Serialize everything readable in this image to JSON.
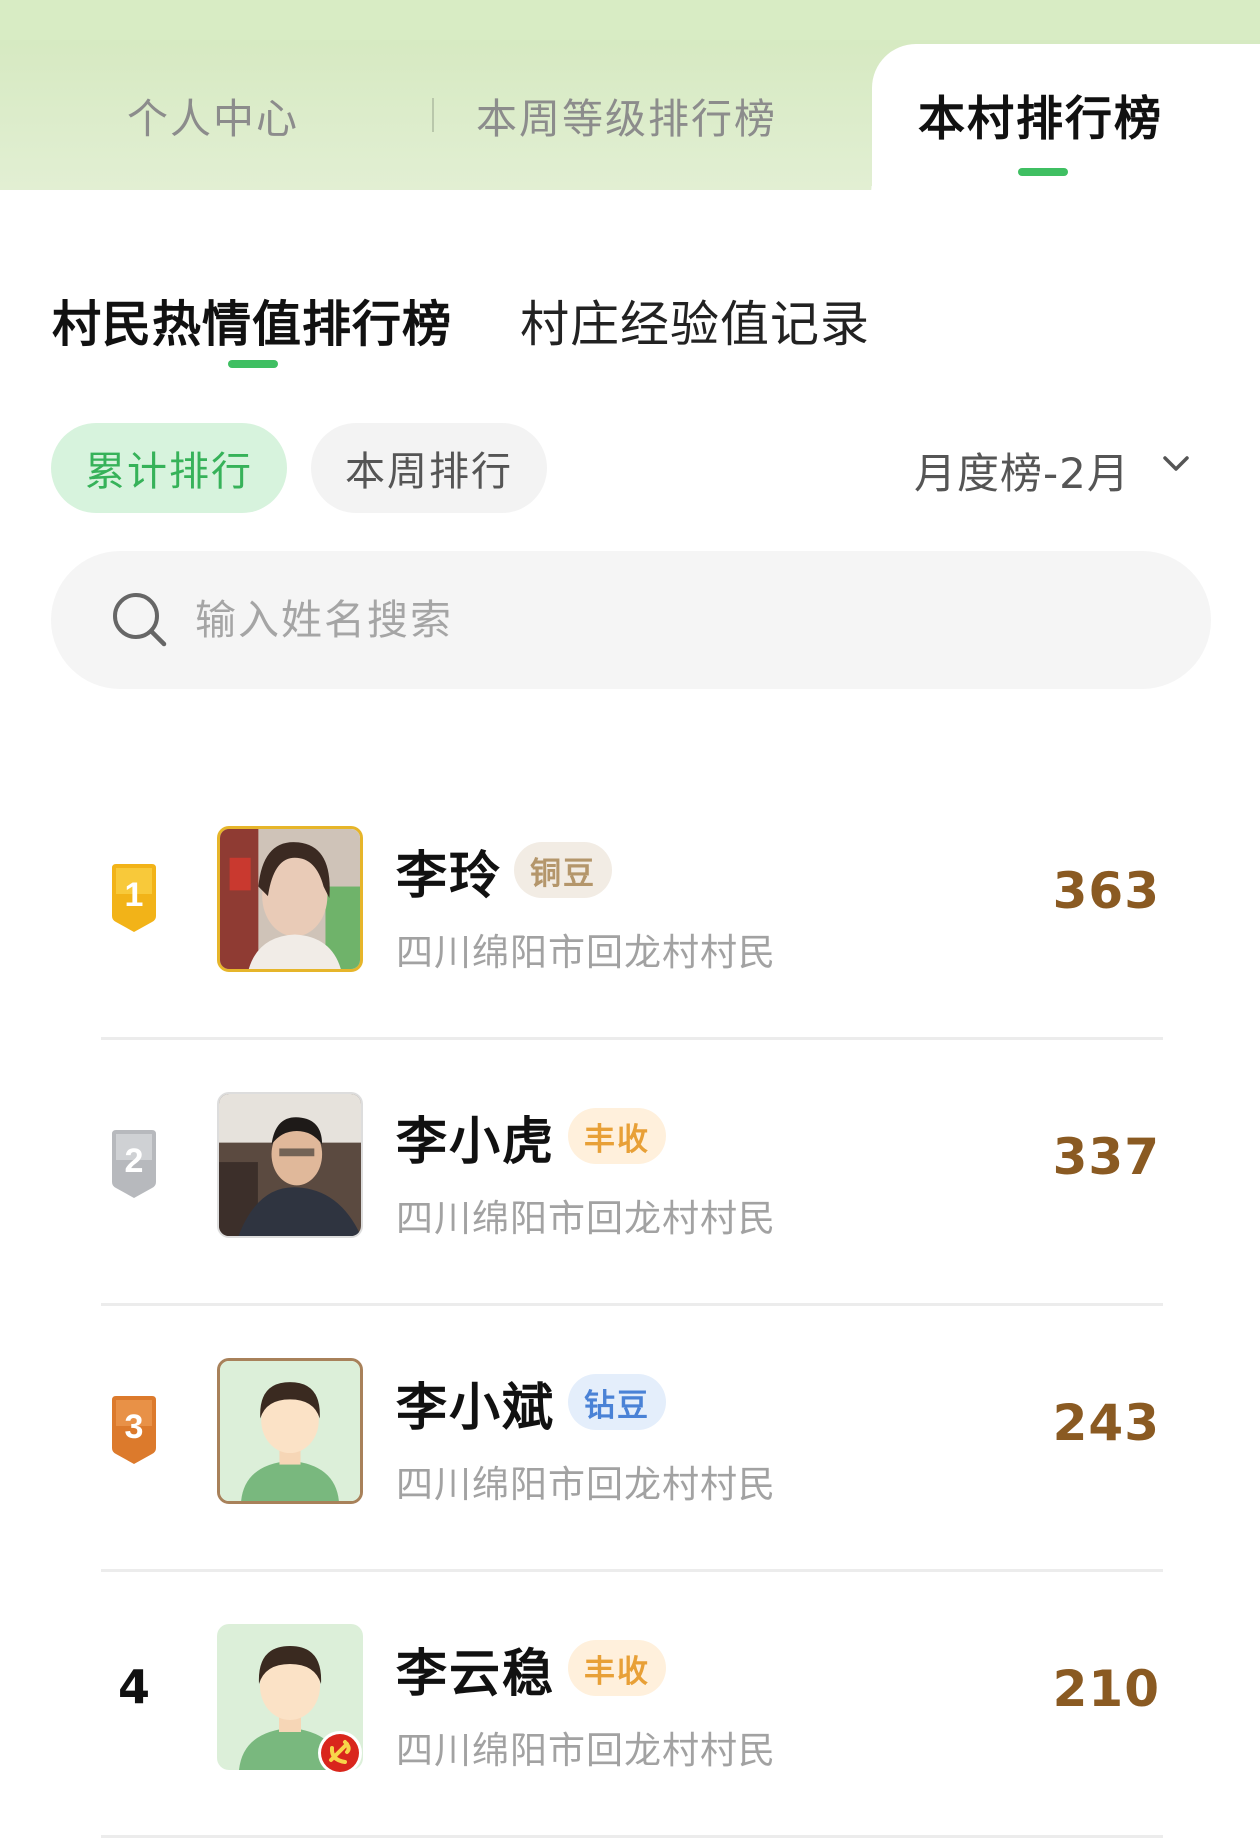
{
  "top_tabs": [
    {
      "label": "个人中心"
    },
    {
      "label": "本周等级排行榜"
    },
    {
      "label": "本村排行榜"
    }
  ],
  "sub_tabs": [
    {
      "label": "村民热情值排行榜"
    },
    {
      "label": "村庄经验值记录"
    }
  ],
  "filters": {
    "total_label": "累计排行",
    "week_label": "本周排行",
    "period_label": "月度榜-2月"
  },
  "search": {
    "placeholder": "输入姓名搜索"
  },
  "ranking": [
    {
      "rank": "1",
      "name": "李玲",
      "tag": "铜豆",
      "location": "四川绵阳市回龙村村民",
      "score": "363"
    },
    {
      "rank": "2",
      "name": "李小虎",
      "tag": "丰收",
      "location": "四川绵阳市回龙村村民",
      "score": "337"
    },
    {
      "rank": "3",
      "name": "李小斌",
      "tag": "钻豆",
      "location": "四川绵阳市回龙村村民",
      "score": "243"
    },
    {
      "rank": "4",
      "name": "李云稳",
      "tag": "丰收",
      "location": "四川绵阳市回龙村村民",
      "score": "210"
    }
  ],
  "colors": {
    "accent_green": "#3fbf62",
    "score_brown": "#8a5a22",
    "header_green": "#d3e8bd"
  }
}
